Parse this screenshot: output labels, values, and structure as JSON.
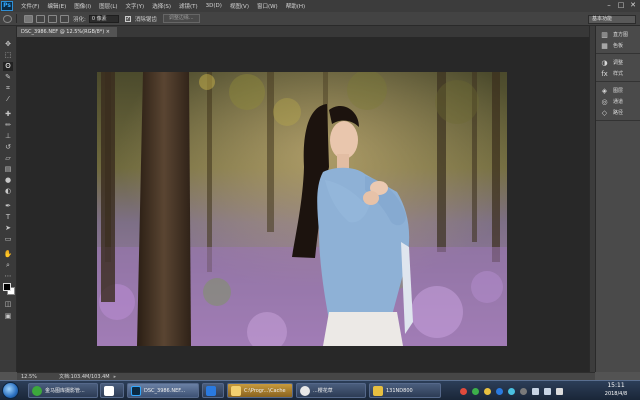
{
  "app": {
    "logo": "Ps",
    "menu": [
      "文件(F)",
      "编辑(E)",
      "图像(I)",
      "图层(L)",
      "文字(Y)",
      "选择(S)",
      "滤镜(T)",
      "3D(D)",
      "视图(V)",
      "窗口(W)",
      "帮助(H)"
    ],
    "window_controls": [
      "–",
      "□",
      "✕"
    ]
  },
  "options_bar": {
    "feather_label": "羽化:",
    "feather_value": "0 像素",
    "antialias_label": "消除锯齿",
    "refine_edge_label": "调整边缘...",
    "workspace": "基本功能"
  },
  "document": {
    "tab_title": "DSC_3986.NEF @ 12.5%(RGB/8*) ×"
  },
  "toolbar": {
    "tools": [
      "move-tool",
      "marquee-tool",
      "lasso-tool",
      "quick-select-tool",
      "crop-tool",
      "eyedropper-tool",
      "healing-brush-tool",
      "brush-tool",
      "clone-stamp-tool",
      "history-brush-tool",
      "eraser-tool",
      "gradient-tool",
      "blur-tool",
      "dodge-tool",
      "pen-tool",
      "type-tool",
      "path-select-tool",
      "shape-tool",
      "hand-tool",
      "zoom-tool"
    ]
  },
  "panels": {
    "groups": [
      [
        {
          "icon": "histogram-icon",
          "label": "直方图"
        },
        {
          "icon": "swatches-icon",
          "label": "色板"
        }
      ],
      [
        {
          "icon": "adjustments-icon",
          "label": "调整"
        },
        {
          "icon": "styles-icon",
          "label": "样式"
        }
      ],
      [
        {
          "icon": "layers-icon",
          "label": "图层"
        },
        {
          "icon": "channels-icon",
          "label": "通道"
        },
        {
          "icon": "paths-icon",
          "label": "路径"
        }
      ]
    ]
  },
  "status": {
    "zoom": "12.5%",
    "doc_size": "文档:103.4M/103.4M"
  },
  "taskbar": {
    "tasks": [
      {
        "label": "金马图库摄影管...",
        "icon_color": "#3ca83c"
      },
      {
        "label": "",
        "icon_color": "#ffffff"
      },
      {
        "label": "DSC_3986.NEF...",
        "icon_color": "#0b2a43"
      },
      {
        "label": "",
        "icon_color": "#2a7ae0"
      },
      {
        "label": "C:\\Progr...\\Cache",
        "icon_color": "#d9a030"
      },
      {
        "label": "...樱花草",
        "icon_color": "#e8e8e8"
      },
      {
        "label": "131ND800",
        "icon_color": "#e8c040"
      }
    ],
    "clock_time": "15:11",
    "clock_date": "2018/4/8"
  },
  "colors": {
    "foreground": "#000000",
    "background": "#ffffff",
    "accent": "#31a8ff"
  }
}
